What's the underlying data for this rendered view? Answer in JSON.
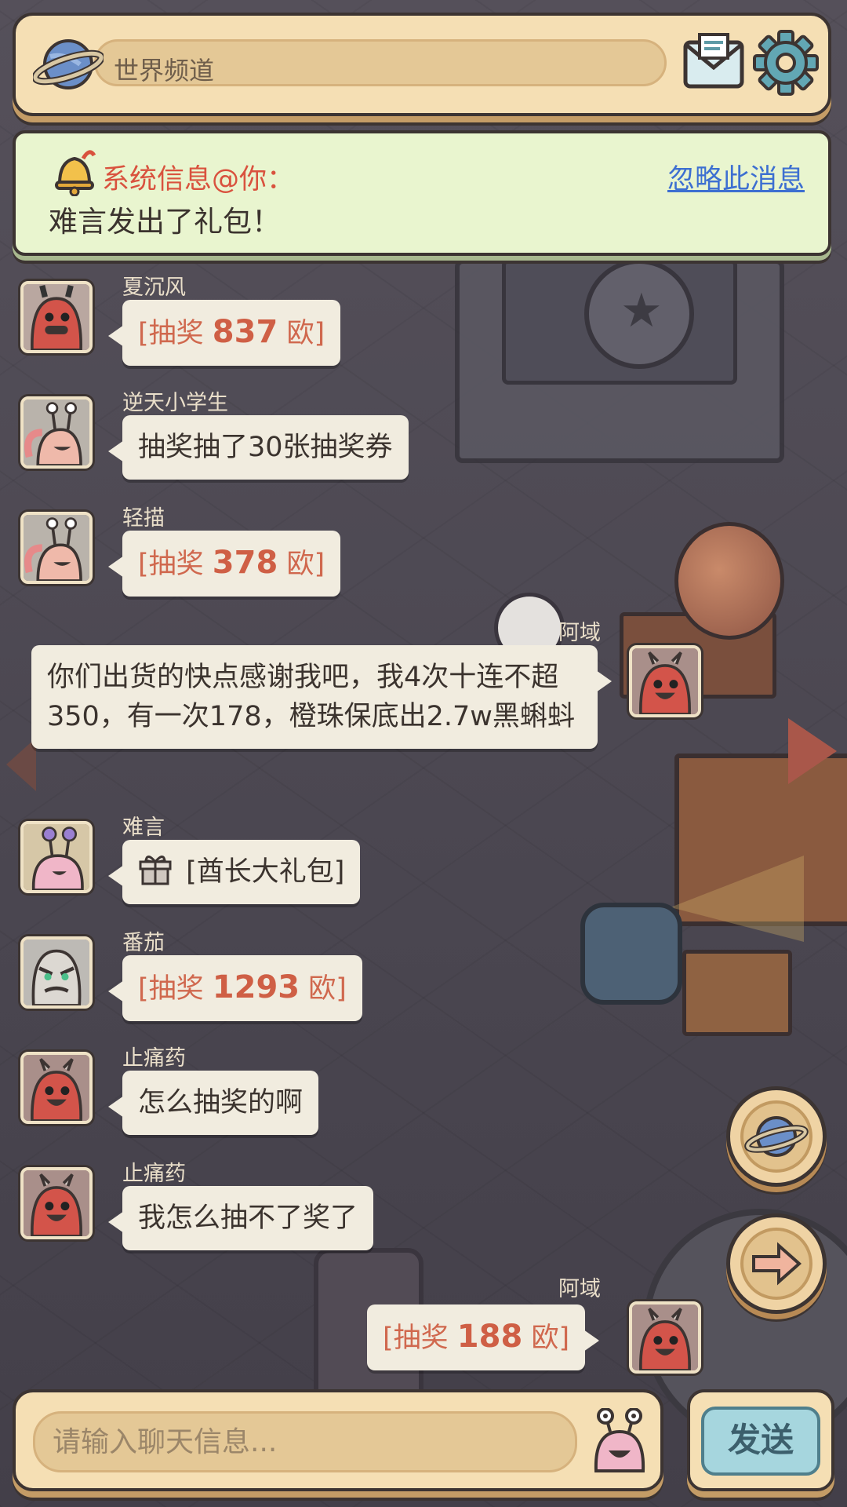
{
  "header": {
    "channel_title": "世界频道",
    "icons": {
      "channel": "planet-icon",
      "mail": "mail-icon",
      "settings": "gear-icon"
    }
  },
  "notice": {
    "title": "系统信息@你：",
    "ignore_label": "忽略此消息",
    "body": "难言发出了礼包！",
    "icon": "bell-icon"
  },
  "messages": [
    {
      "sender": "夏沉风",
      "side": "left",
      "type": "lottery",
      "prefix": "[抽奖",
      "number": "837",
      "suffix": "欧]"
    },
    {
      "sender": "逆天小学生",
      "side": "left",
      "type": "text",
      "text": "抽奖抽了30张抽奖券"
    },
    {
      "sender": "轻描",
      "side": "left",
      "type": "lottery",
      "prefix": "[抽奖",
      "number": "378",
      "suffix": "欧]"
    },
    {
      "sender": "阿域",
      "side": "right",
      "type": "text",
      "text": "你们出货的快点感谢我吧，我4次十连不超350，有一次178，橙珠保底出2.7w黑蝌蚪"
    },
    {
      "sender": "难言",
      "side": "left",
      "type": "gift",
      "text": "[酋长大礼包]"
    },
    {
      "sender": "番茄",
      "side": "left",
      "type": "lottery",
      "prefix": "[抽奖",
      "number": "1293",
      "suffix": "欧]"
    },
    {
      "sender": "止痛药",
      "side": "left",
      "type": "text",
      "text": "怎么抽奖的啊"
    },
    {
      "sender": "止痛药",
      "side": "left",
      "type": "text",
      "text": "我怎么抽不了奖了"
    },
    {
      "sender": "阿域",
      "side": "right",
      "type": "lottery",
      "prefix": "[抽奖",
      "number": "188",
      "suffix": "欧]"
    }
  ],
  "side_buttons": {
    "planet": "planet-icon",
    "forward": "arrow-right-icon"
  },
  "input": {
    "placeholder": "请输入聊天信息...",
    "value": "",
    "emoji_icon": "snail-face-icon",
    "send_label": "发送"
  },
  "colors": {
    "panel": "#f5dfb4",
    "notice_bg": "#e9f5cf",
    "notice_title": "#d9523e",
    "link": "#3d6fd1",
    "lottery": "#d0684e",
    "bubble": "#f1ecdf",
    "send_button": "#a6d6de"
  }
}
